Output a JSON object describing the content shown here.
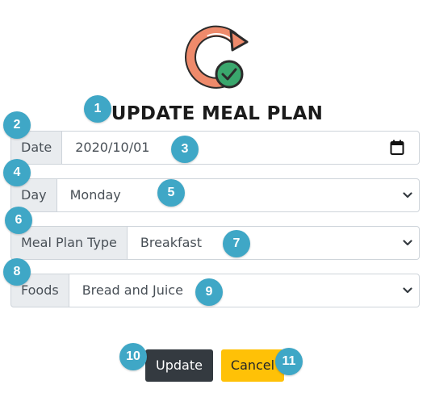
{
  "title": "UPDATE MEAL PLAN",
  "form": {
    "date": {
      "label": "Date",
      "value": "2020/10/01"
    },
    "day": {
      "label": "Day",
      "value": "Monday"
    },
    "meal_plan_type": {
      "label": "Meal Plan Type",
      "value": "Breakfast"
    },
    "foods": {
      "label": "Foods",
      "value": "Bread and Juice"
    }
  },
  "buttons": {
    "update": "Update",
    "cancel": "Cancel"
  },
  "markers": [
    "1",
    "2",
    "3",
    "4",
    "5",
    "6",
    "7",
    "8",
    "9",
    "10",
    "11"
  ],
  "colors": {
    "marker": "#3fa7c6",
    "update_button": "#343a40",
    "cancel_button": "#ffc107",
    "logo_ring": "#ee8a6b",
    "logo_check": "#3aa76d"
  },
  "icons": {
    "logo": "refresh-check-icon",
    "date_picker": "calendar-icon",
    "dropdown": "chevron-down-icon"
  }
}
